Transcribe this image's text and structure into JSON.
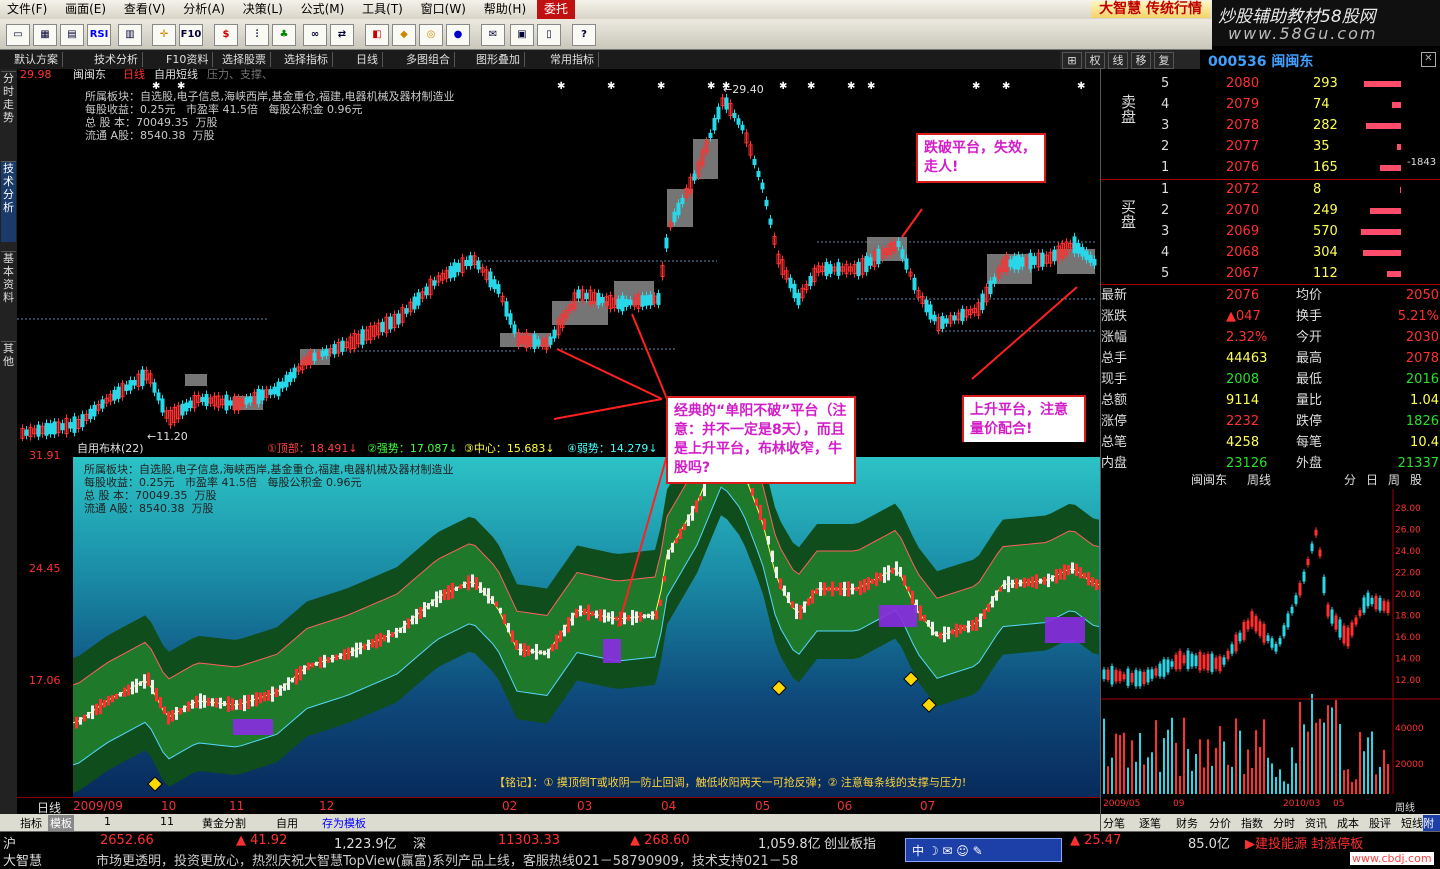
{
  "menubar": {
    "items": [
      "文件(F)",
      "画面(E)",
      "查看(V)",
      "分析(A)",
      "决策(L)",
      "公式(M)",
      "工具(T)",
      "窗口(W)",
      "帮助(H)",
      "委托"
    ],
    "brand": "大智慧 传统行情"
  },
  "watermark": {
    "line1": "炒股辅助教材58股网",
    "line2": "www.58Gu.com"
  },
  "toolbar": {
    "rsi_label": "RSI",
    "f10_label": "F10",
    "dollar_label": "$"
  },
  "bar2": {
    "items": [
      "默认方案",
      "技术分析",
      "F10资料",
      "选择股票",
      "选择指标",
      "日线",
      "多图组合",
      "图形叠加",
      "常用指标"
    ],
    "right_items": [
      "权",
      "线",
      "移",
      "复"
    ]
  },
  "stock_code": "000536 闽闽东",
  "left_tabs": [
    "分时走势",
    "技术分析",
    "基本资料",
    "其他"
  ],
  "upper": {
    "top_value": "29.98",
    "title": "闽闽东",
    "period": "日线",
    "indicator": "自用短线",
    "indicator_extra": "压力、支撑、",
    "info": [
      "所属板块：自选股,电子信息,海峡西岸,基金重仓,福建,电器机械及器材制造业",
      "每股收益：0.25元   市盈率 41.5倍   每股公积金 0.96元",
      "总 股 本：70049.35  万股",
      "流通 A股：8540.38  万股"
    ],
    "peak_label": "←29.40",
    "low_label": "←11.20"
  },
  "lower": {
    "header": "自用布林(22)",
    "legend": [
      "①顶部：18.491↓",
      "②强势：17.087↓",
      "③中心：15.683↓",
      "④弱势：14.279↓"
    ],
    "y_ticks": [
      "31.91",
      "24.45",
      "17.06"
    ],
    "footer_note": "【铭记】：① 摸顶倒T或收阴一防止回调，触低收阳两天一可抢反弹；② 注意每条线的支撑与压力!"
  },
  "callouts": {
    "break": "跌破平台，失效，走人!",
    "classic": "经典的“单阳不破”平台（注意：并不一定是8天），而且是上升平台，布林收窄，牛股吗?",
    "rising": "上升平台，注意量价配合!"
  },
  "date_axis": {
    "period_label": "日线",
    "labels": [
      "2009/09",
      "10",
      "11",
      "12",
      "02",
      "03",
      "04",
      "05",
      "06",
      "07"
    ]
  },
  "bottom_tabs": [
    "指标",
    "模板",
    "1",
    "11",
    "黄金分割",
    "自用",
    "存为模板"
  ],
  "orderbook": {
    "sell_label": "卖盘",
    "buy_label": "买盘",
    "sell": [
      {
        "lvl": "5",
        "price": "2080",
        "vol": "293"
      },
      {
        "lvl": "4",
        "price": "2079",
        "vol": "74"
      },
      {
        "lvl": "3",
        "price": "2078",
        "vol": "282"
      },
      {
        "lvl": "2",
        "price": "2077",
        "vol": "35"
      },
      {
        "lvl": "1",
        "price": "2076",
        "vol": "165"
      }
    ],
    "buy": [
      {
        "lvl": "1",
        "price": "2072",
        "vol": "8"
      },
      {
        "lvl": "2",
        "price": "2070",
        "vol": "249"
      },
      {
        "lvl": "3",
        "price": "2069",
        "vol": "570"
      },
      {
        "lvl": "4",
        "price": "2068",
        "vol": "304"
      },
      {
        "lvl": "5",
        "price": "2067",
        "vol": "112"
      }
    ],
    "diff": "-1843"
  },
  "quote": [
    {
      "l1": "最新",
      "v1": "2076",
      "l2": "均价",
      "v2": "2050"
    },
    {
      "l1": "涨跌",
      "v1": "▲047",
      "l2": "换手",
      "v2": "5.21%"
    },
    {
      "l1": "涨幅",
      "v1": "2.32%",
      "l2": "今开",
      "v2": "2030"
    },
    {
      "l1": "总手",
      "v1": "44463",
      "l2": "最高",
      "v2": "2078"
    },
    {
      "l1": "现手",
      "v1": "2008",
      "l2": "最低",
      "v2": "2016"
    },
    {
      "l1": "总额",
      "v1": "9114",
      "l2": "量比",
      "v2": "1.04"
    },
    {
      "l1": "涨停",
      "v1": "2232",
      "l2": "跌停",
      "v2": "1826"
    },
    {
      "l1": "总笔",
      "v1": "4258",
      "l2": "每笔",
      "v2": "10.4"
    },
    {
      "l1": "内盘",
      "v1": "23126",
      "l2": "外盘",
      "v2": "21337"
    }
  ],
  "mini": {
    "name": "闽闽东",
    "period": "周线",
    "tabs": [
      "分",
      "日",
      "周",
      "股"
    ],
    "y_ticks": [
      "28.00",
      "26.00",
      "24.00",
      "22.00",
      "20.00",
      "18.00",
      "16.00",
      "14.00",
      "12.00"
    ],
    "vol_ticks": [
      "40000",
      "20000"
    ],
    "x_labels": [
      "2009/05",
      "09",
      "2010/03",
      "05"
    ],
    "bottom_tabs": [
      "分笔",
      "逐笔",
      "财务",
      "分价",
      "指数",
      "分时",
      "资讯",
      "成本",
      "股评",
      "短线",
      "附图"
    ],
    "bottom_right": "周线"
  },
  "status1": {
    "market": "沪",
    "idx1": "2652.66",
    "chg1": "▲ 41.92",
    "amt1": "1,223.9亿",
    "mkt2": "深",
    "idx2": "11303.33",
    "chg2": "▲ 268.60",
    "amt2": "1,059.8亿",
    "mkt3": "创业板指",
    "chg3": "▲ 25.47",
    "amt3": "85.0亿",
    "news": "▶建投能源 封涨停板"
  },
  "status2": {
    "brand": "大智慧",
    "ticker": "市场更透明，投资更放心，热烈庆祝大智慧TopView(赢富)系列产品上线，客服热线021－58790909，技术支持021－58",
    "url": "www.cbdj.com"
  },
  "sysicons": "中 ☽ ✉ ☺ ✎",
  "colors": {
    "up": "#ff3030",
    "down": "#28d8e8",
    "accent": "#d21ec8"
  }
}
